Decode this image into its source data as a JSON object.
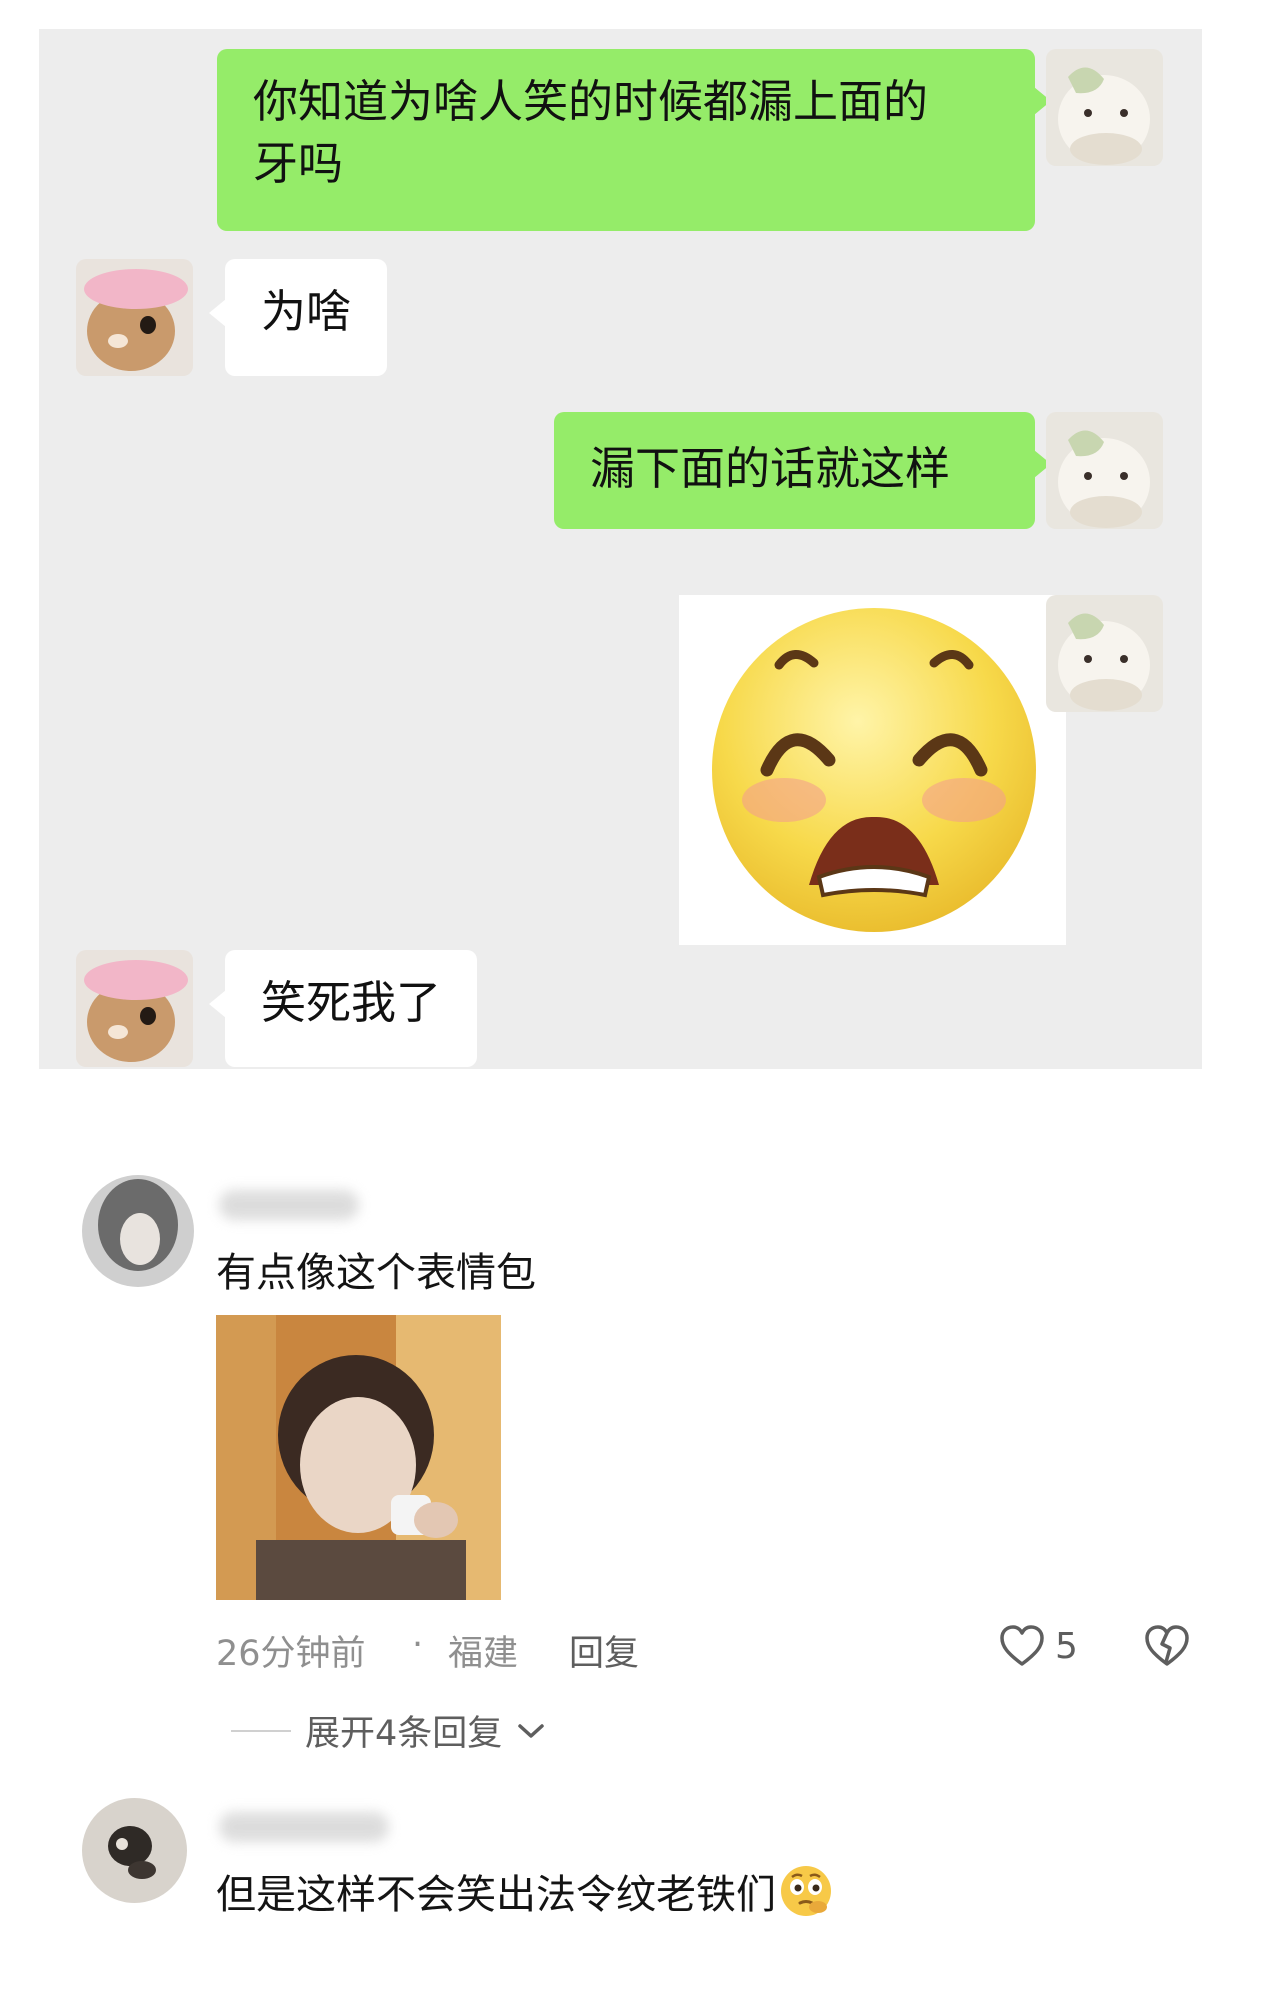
{
  "chat": {
    "messages": [
      {
        "side": "right",
        "text_line1": "你知道为啥人笑的时候都漏上面的",
        "text_line2": "牙吗"
      },
      {
        "side": "left",
        "text": "为啥"
      },
      {
        "side": "right",
        "text": "漏下面的话就这样"
      },
      {
        "side": "right",
        "type": "sticker",
        "sticker_icon": "laughing-emoji-sticker"
      },
      {
        "side": "left",
        "text": "笑死我了"
      }
    ],
    "colors": {
      "background": "#ededed",
      "sent_bubble": "#95ec69",
      "received_bubble": "#ffffff"
    }
  },
  "comments": [
    {
      "text": "有点像这个表情包",
      "has_photo": true,
      "time": "26分钟前",
      "dot": "·",
      "location": "福建",
      "reply_label": "回复",
      "likes": "5",
      "expand_label": "展开4条回复"
    },
    {
      "text": "但是这样不会笑出法令纹老铁们",
      "trailing_emoji_icon": "thinking-face-emoji"
    }
  ]
}
